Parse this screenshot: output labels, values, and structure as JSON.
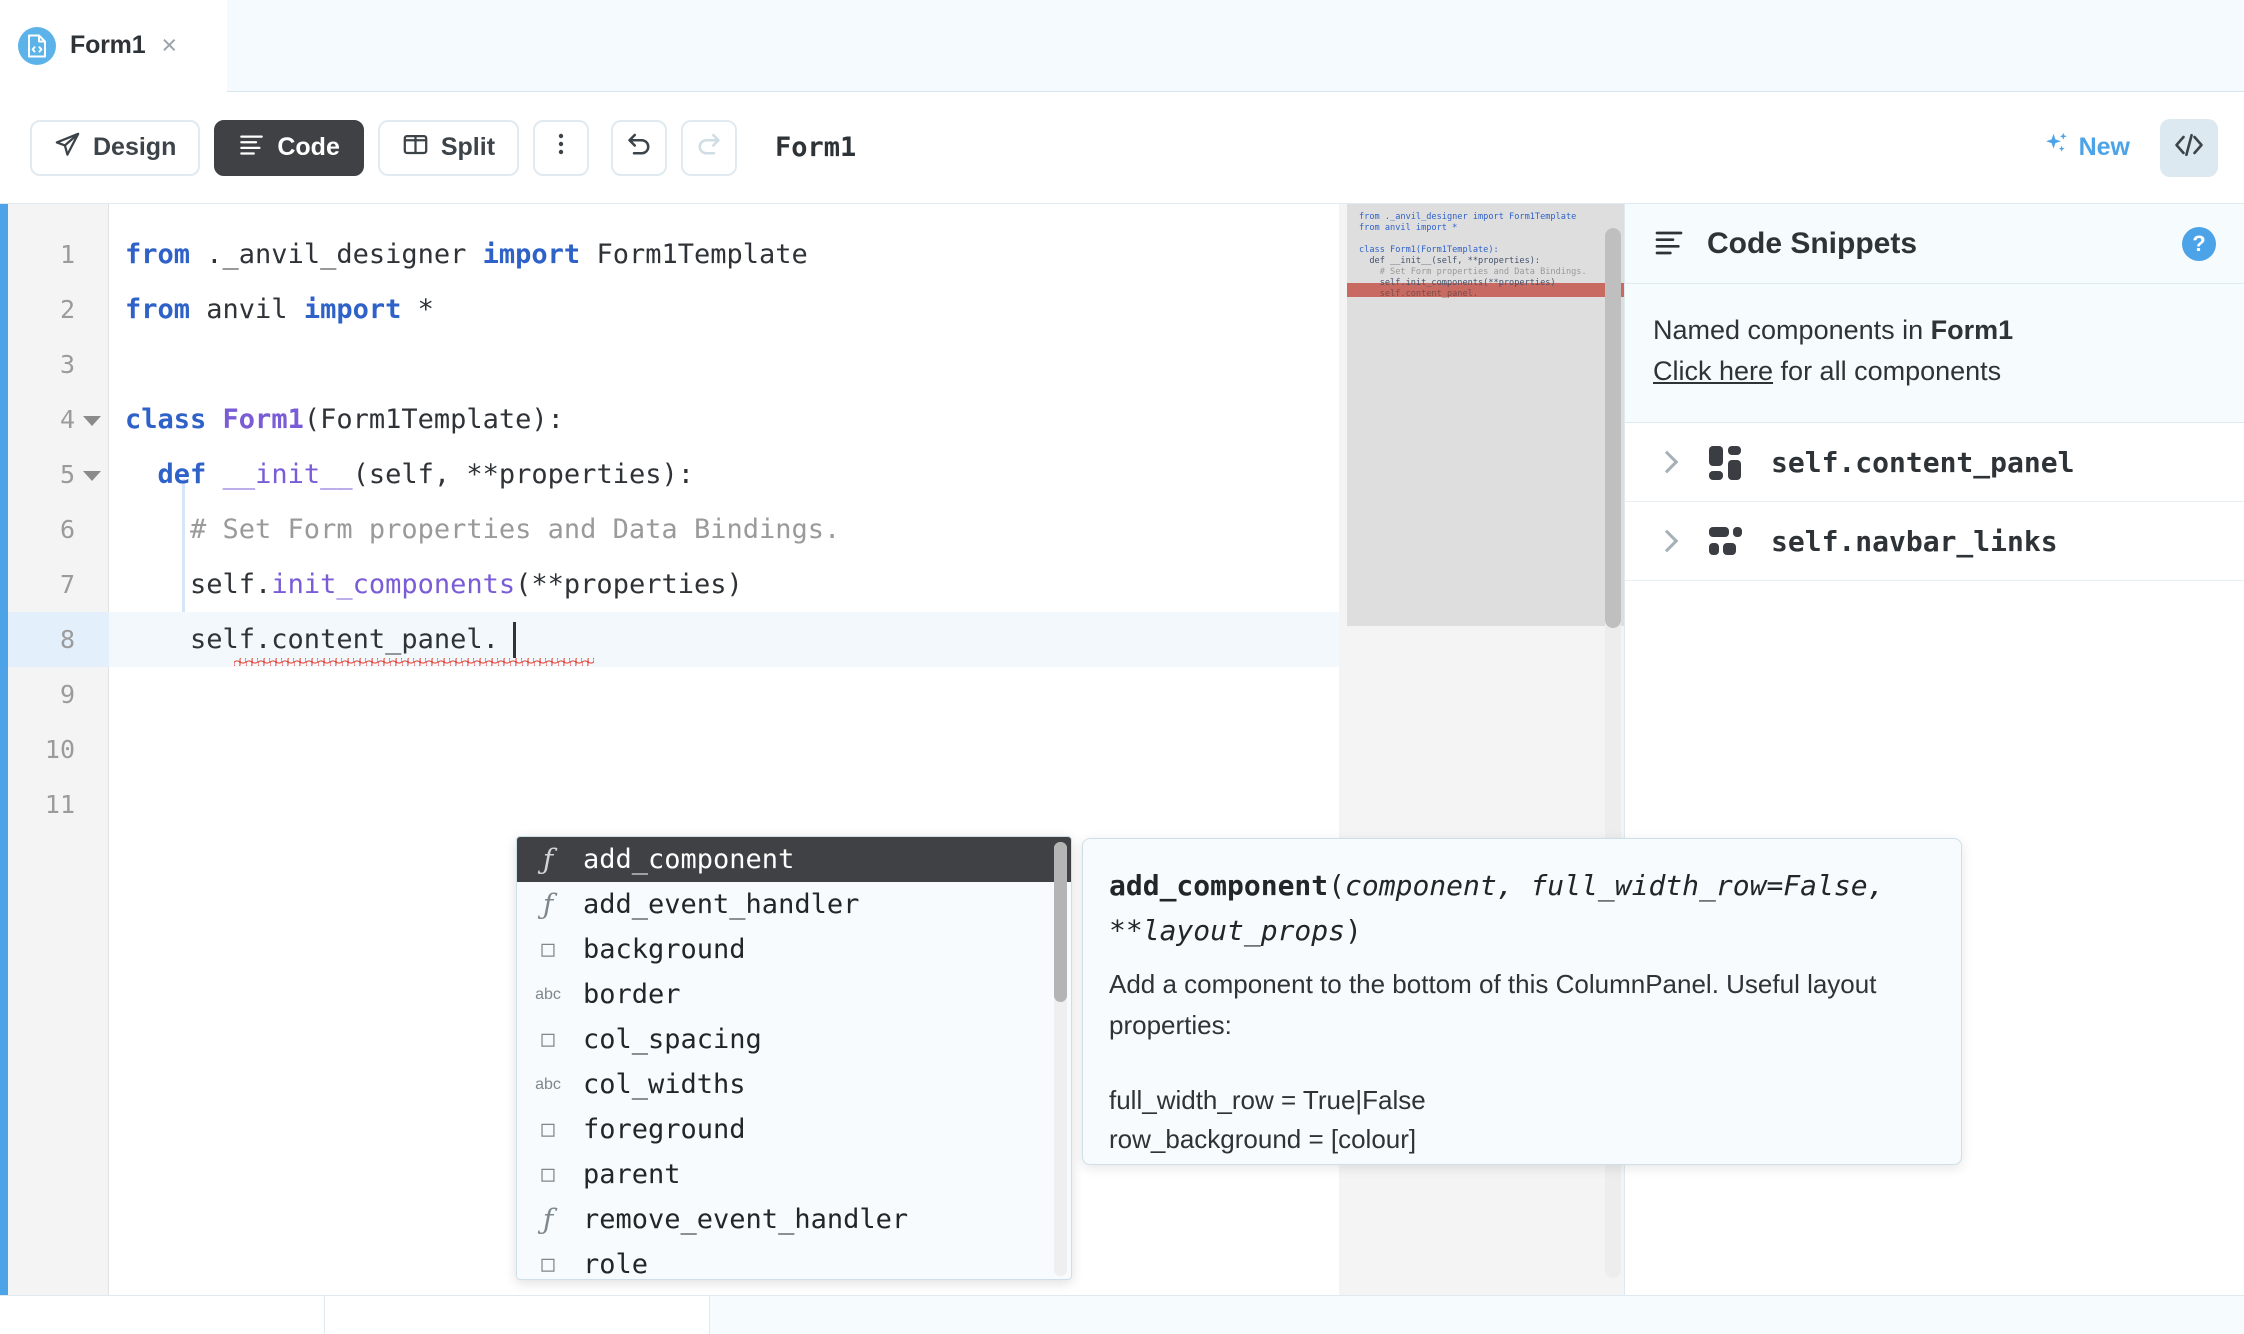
{
  "tab": {
    "label": "Form1",
    "icon": "code-file-icon",
    "close_label": "×"
  },
  "toolbar": {
    "design_label": "Design",
    "code_label": "Code",
    "split_label": "Split",
    "more_label": "⋮",
    "undo_label": "↺",
    "redo_label": "↻",
    "title": "Form1",
    "new_label": "New",
    "code_toggle_label": "</>"
  },
  "editor": {
    "line_numbers": [
      "1",
      "2",
      "3",
      "4",
      "5",
      "6",
      "7",
      "8",
      "9",
      "10",
      "11"
    ],
    "current_line": 8,
    "folded_lines": [
      4,
      5
    ],
    "lines": [
      {
        "n": 1,
        "tokens": [
          {
            "t": "from",
            "c": "k-kw"
          },
          {
            "t": " ._anvil_designer ",
            "c": "k-txt"
          },
          {
            "t": "import",
            "c": "k-kw"
          },
          {
            "t": " Form1Template",
            "c": "k-txt"
          }
        ]
      },
      {
        "n": 2,
        "tokens": [
          {
            "t": "from",
            "c": "k-kw"
          },
          {
            "t": " anvil ",
            "c": "k-txt"
          },
          {
            "t": "import",
            "c": "k-kw"
          },
          {
            "t": " *",
            "c": "k-txt"
          }
        ]
      },
      {
        "n": 3,
        "tokens": []
      },
      {
        "n": 4,
        "tokens": [
          {
            "t": "class",
            "c": "k-kw"
          },
          {
            "t": " ",
            "c": "k-txt"
          },
          {
            "t": "Form1",
            "c": "k-cls"
          },
          {
            "t": "(Form1Template):",
            "c": "k-txt"
          }
        ]
      },
      {
        "n": 5,
        "tokens": [
          {
            "t": "  ",
            "c": "k-txt"
          },
          {
            "t": "def",
            "c": "k-kw"
          },
          {
            "t": " ",
            "c": "k-txt"
          },
          {
            "t": "__init__",
            "c": "k-fn"
          },
          {
            "t": "(self, **properties):",
            "c": "k-txt"
          }
        ]
      },
      {
        "n": 6,
        "tokens": [
          {
            "t": "    # Set Form properties and Data Bindings.",
            "c": "k-cmt"
          }
        ]
      },
      {
        "n": 7,
        "tokens": [
          {
            "t": "    self.",
            "c": "k-txt"
          },
          {
            "t": "init_components",
            "c": "k-fn"
          },
          {
            "t": "(**properties)",
            "c": "k-txt"
          }
        ]
      },
      {
        "n": 8,
        "tokens": [
          {
            "t": "    self.content_panel.",
            "c": "k-txt"
          }
        ]
      },
      {
        "n": 9,
        "tokens": []
      },
      {
        "n": 10,
        "tokens": []
      },
      {
        "n": 11,
        "tokens": []
      }
    ]
  },
  "minimap": {
    "lines": [
      "from ._anvil_designer import Form1Template",
      "from anvil import *",
      "",
      "class Form1(Form1Template):",
      "  def __init__(self, **properties):",
      "    # Set Form properties and Data Bindings.",
      "    self.init_components(**properties)",
      "    self.content_panel."
    ],
    "highlight_line": 8,
    "highlight_color": "#c86a62"
  },
  "autocomplete": {
    "items": [
      {
        "kind": "fn",
        "glyph": "ƒ",
        "label": "add_component",
        "selected": true
      },
      {
        "kind": "fn",
        "glyph": "ƒ",
        "label": "add_event_handler",
        "selected": false
      },
      {
        "kind": "box",
        "glyph": "□",
        "label": "background",
        "selected": false
      },
      {
        "kind": "abc",
        "glyph": "abc",
        "label": "border",
        "selected": false
      },
      {
        "kind": "box",
        "glyph": "□",
        "label": "col_spacing",
        "selected": false
      },
      {
        "kind": "abc",
        "glyph": "abc",
        "label": "col_widths",
        "selected": false
      },
      {
        "kind": "box",
        "glyph": "□",
        "label": "foreground",
        "selected": false
      },
      {
        "kind": "box",
        "glyph": "□",
        "label": "parent",
        "selected": false
      },
      {
        "kind": "fn",
        "glyph": "ƒ",
        "label": "remove_event_handler",
        "selected": false
      },
      {
        "kind": "box",
        "glyph": "□",
        "label": "role",
        "selected": false
      }
    ]
  },
  "doc_popup": {
    "name": "add_component",
    "signature_params": "(component, full_width_row=False, **layout_props)",
    "sig_part_open": "(",
    "sig_part_args": "component, full_width_row=False, **layout_props",
    "sig_part_close": ")",
    "description": "Add a component to the bottom of this ColumnPanel. Useful layout properties:",
    "prop_1": "full_width_row = True|False",
    "prop_2": "row_background = [colour]"
  },
  "sidebar": {
    "title": "Code Snippets",
    "help_label": "?",
    "menu_icon": "list-icon",
    "intro_prefix": "Named components in ",
    "intro_form": "Form1",
    "link_text": "Click here",
    "link_suffix": " for all components",
    "items": [
      {
        "label": "self.content_panel",
        "icon": "column-panel-icon"
      },
      {
        "label": "self.navbar_links",
        "icon": "flow-panel-icon"
      }
    ]
  },
  "colors": {
    "accent_blue": "#4da3e8",
    "active_dark": "#3f4144",
    "panel_tint": "#f6fbfd",
    "current_line": "#f3f8fd",
    "error_red": "#e03b2f"
  }
}
